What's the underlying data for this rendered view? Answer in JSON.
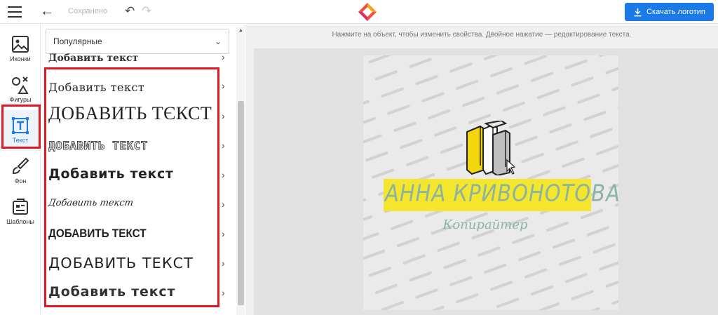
{
  "topbar": {
    "saved_label": "Сохранено",
    "download_label": "Скачать логотип",
    "accent_color": "#1c7ae8"
  },
  "rail": {
    "items": [
      {
        "label": "Иконки",
        "icon": "image-icon"
      },
      {
        "label": "Фигуры",
        "icon": "shapes-icon"
      },
      {
        "label": "Текст",
        "icon": "text-icon",
        "active": true
      },
      {
        "label": "Фон",
        "icon": "brush-icon"
      },
      {
        "label": "Шаблоны",
        "icon": "templates-icon"
      }
    ]
  },
  "panel": {
    "dropdown_value": "Популярные",
    "partial_item": "Добавить текст",
    "items": [
      "Добавить текст",
      "ДОБАВИТЬ ТЄКСТ",
      "ДОБАВИТЬ ТЕКСТ",
      "Добавить текст",
      "Добавить текст",
      "ДОБАВИТЬ ТЕКСТ",
      "ДОБАВИТЬ ТЕКСТ",
      "Добавить текст"
    ]
  },
  "canvas": {
    "hint": "Нажмите на объект, чтобы изменить свойства. Двойное нажатие — редактирование текста.",
    "logo_name": "АННА КРИВОНОТОВА",
    "logo_subtitle": "Копирайтер",
    "brand_yellow": "#f4e62c",
    "brand_green": "#8ab3a1",
    "highlight_red": "#e01a22"
  }
}
